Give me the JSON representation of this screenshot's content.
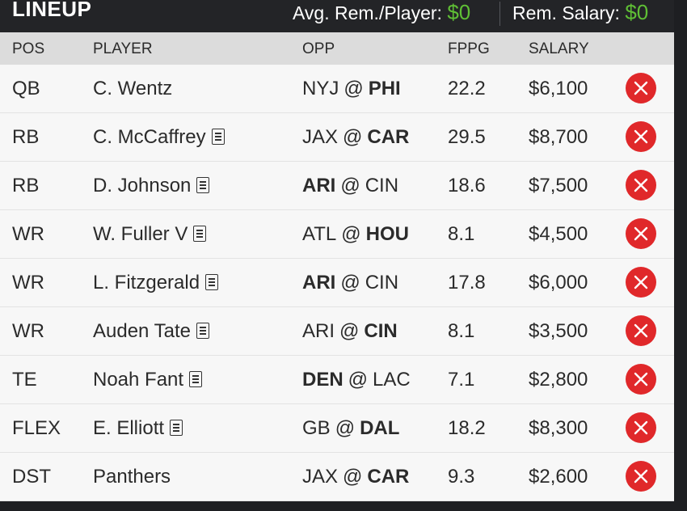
{
  "header": {
    "title": "LINEUP",
    "avg_rem_label": "Avg. Rem./Player:",
    "avg_rem_value": "$0",
    "rem_salary_label": "Rem. Salary:",
    "rem_salary_value": "$0"
  },
  "columns": {
    "pos": "POS",
    "player": "PLAYER",
    "opp": "OPP",
    "fppg": "FPPG",
    "salary": "SALARY"
  },
  "colors": {
    "accent_green": "#5fbf35",
    "remove_red": "#e0282a",
    "header_bg": "#232427"
  },
  "rows": [
    {
      "pos": "QB",
      "player": "C. Wentz",
      "news": false,
      "away": "NYJ",
      "home": "PHI",
      "team_side": "home",
      "fppg": "22.2",
      "salary": "$6,100"
    },
    {
      "pos": "RB",
      "player": "C. McCaffrey",
      "news": true,
      "away": "JAX",
      "home": "CAR",
      "team_side": "home",
      "fppg": "29.5",
      "salary": "$8,700"
    },
    {
      "pos": "RB",
      "player": "D. Johnson",
      "news": true,
      "away": "ARI",
      "home": "CIN",
      "team_side": "away",
      "fppg": "18.6",
      "salary": "$7,500"
    },
    {
      "pos": "WR",
      "player": "W. Fuller V",
      "news": true,
      "away": "ATL",
      "home": "HOU",
      "team_side": "home",
      "fppg": "8.1",
      "salary": "$4,500"
    },
    {
      "pos": "WR",
      "player": "L. Fitzgerald",
      "news": true,
      "away": "ARI",
      "home": "CIN",
      "team_side": "away",
      "fppg": "17.8",
      "salary": "$6,000"
    },
    {
      "pos": "WR",
      "player": "Auden Tate",
      "news": true,
      "away": "ARI",
      "home": "CIN",
      "team_side": "home",
      "fppg": "8.1",
      "salary": "$3,500"
    },
    {
      "pos": "TE",
      "player": "Noah Fant",
      "news": true,
      "away": "DEN",
      "home": "LAC",
      "team_side": "away",
      "fppg": "7.1",
      "salary": "$2,800"
    },
    {
      "pos": "FLEX",
      "player": "E. Elliott",
      "news": true,
      "away": "GB",
      "home": "DAL",
      "team_side": "home",
      "fppg": "18.2",
      "salary": "$8,300"
    },
    {
      "pos": "DST",
      "player": "Panthers",
      "news": false,
      "away": "JAX",
      "home": "CAR",
      "team_side": "home",
      "fppg": "9.3",
      "salary": "$2,600"
    }
  ]
}
